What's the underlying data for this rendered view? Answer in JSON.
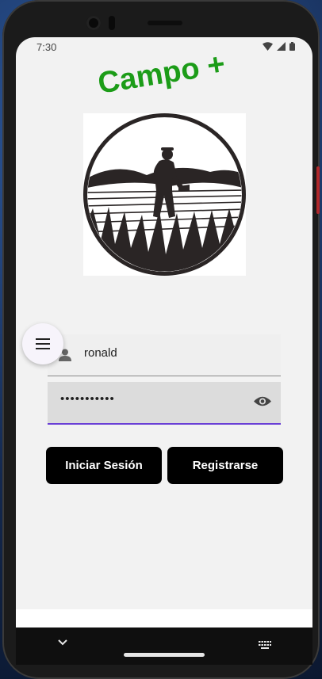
{
  "status_bar": {
    "time": "7:30"
  },
  "app": {
    "title": "Campo +"
  },
  "logo": {
    "description_icon": "farmer-field-logo"
  },
  "menu": {
    "icon": "hamburger-menu-icon"
  },
  "form": {
    "username": {
      "value": "ronald",
      "icon": "person-icon"
    },
    "password": {
      "value": "•••••••••••",
      "icon": "eye-icon"
    }
  },
  "buttons": {
    "login_label": "Iniciar Sesión",
    "register_label": "Registrarse"
  },
  "colors": {
    "title": "#1c9c18",
    "focus_underline": "#6a3fd6",
    "button_bg": "#000000"
  }
}
